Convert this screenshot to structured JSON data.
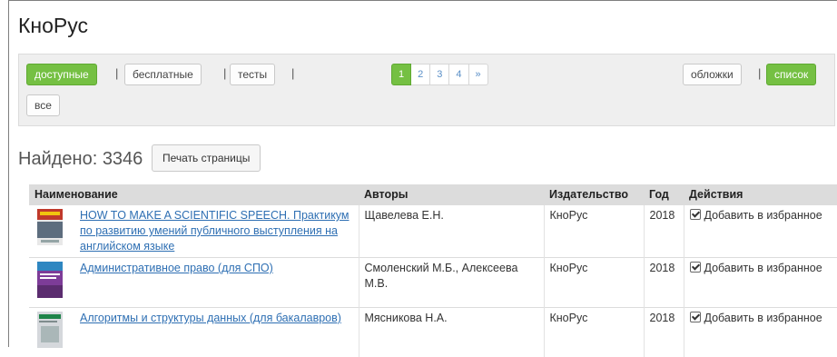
{
  "header": {
    "title": "КноРус"
  },
  "filters": {
    "available": "доступные",
    "free": "бесплатные",
    "tests": "тесты",
    "all": "все",
    "separator": "|"
  },
  "pagination": {
    "pages": [
      "1",
      "2",
      "3",
      "4"
    ],
    "next": "»",
    "active_page": "1"
  },
  "view": {
    "covers": "обложки",
    "list": "список"
  },
  "results": {
    "found_label": "Найдено: 3346",
    "print_label": "Печать страницы"
  },
  "table": {
    "headers": {
      "name": "Наименование",
      "authors": "Авторы",
      "publisher": "Издательство",
      "year": "Год",
      "actions": "Действия"
    },
    "rows": [
      {
        "title": "HOW TO MAKE A SCIENTIFIC SPEECH. Практикум по развитию умений публичного выступления на английском языке",
        "authors": "Щавелева Е.Н.",
        "publisher": "КноРус",
        "year": "2018",
        "action": "Добавить в избранное"
      },
      {
        "title": "Административное право (для СПО)",
        "authors": "Смоленский М.Б., Алексеева М.В.",
        "publisher": "КноРус",
        "year": "2018",
        "action": "Добавить в избранное"
      },
      {
        "title": "Алгоритмы и структуры данных (для бакалавров)",
        "authors": "Мясникова Н.А.",
        "publisher": "КноРус",
        "year": "2018",
        "action": "Добавить в избранное"
      }
    ]
  },
  "colors": {
    "accent_green": "#75c043",
    "link_blue": "#2e6fb3",
    "toolbar_bg": "#efefef",
    "header_bg": "#dcdcdc"
  }
}
